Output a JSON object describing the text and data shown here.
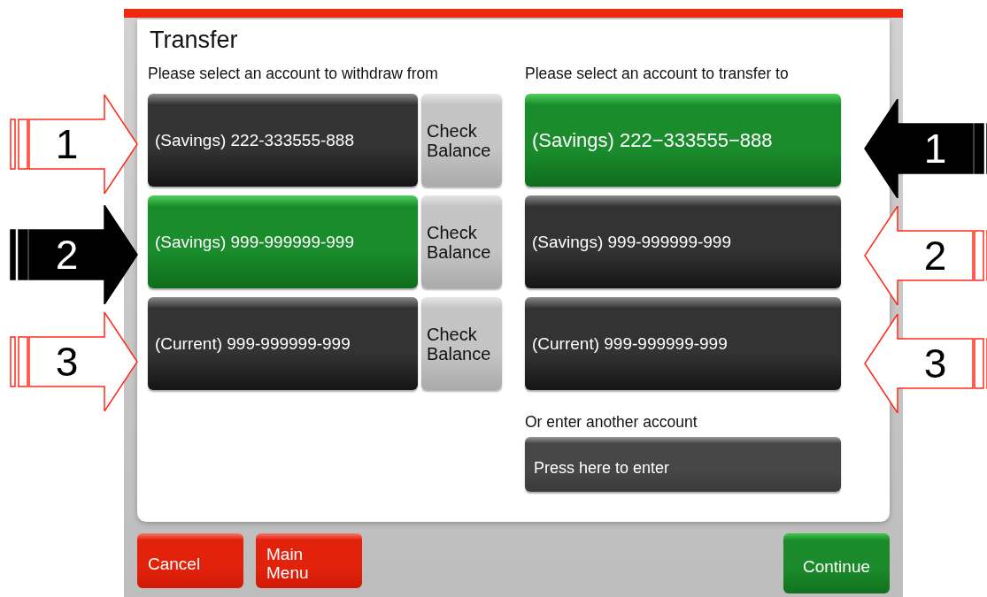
{
  "title": "Transfer",
  "from": {
    "heading": "Please select an account to withdraw from",
    "accounts": [
      {
        "label": "(Savings) 222-333555-888",
        "balance_label": "Check Balance",
        "selected": false,
        "marker": "1"
      },
      {
        "label": "(Savings) 999-999999-999",
        "balance_label": "Check Balance",
        "selected": true,
        "marker": "2"
      },
      {
        "label": "(Current) 999-999999-999",
        "balance_label": "Check Balance",
        "selected": false,
        "marker": "3"
      }
    ]
  },
  "to": {
    "heading": "Please select an account to transfer to",
    "accounts": [
      {
        "label": "(Savings) 222−333555−888",
        "selected": true,
        "marker": "1"
      },
      {
        "label": "(Savings) 999-999999-999",
        "selected": false,
        "marker": "2"
      },
      {
        "label": "(Current) 999-999999-999",
        "selected": false,
        "marker": "3"
      }
    ],
    "other_label": "Or enter another account",
    "other_button": "Press here to enter"
  },
  "footer": [
    {
      "label": "Cancel",
      "kind": "danger"
    },
    {
      "label": "Main Menu",
      "kind": "danger"
    },
    {
      "label": "Continue",
      "kind": "confirm"
    }
  ]
}
